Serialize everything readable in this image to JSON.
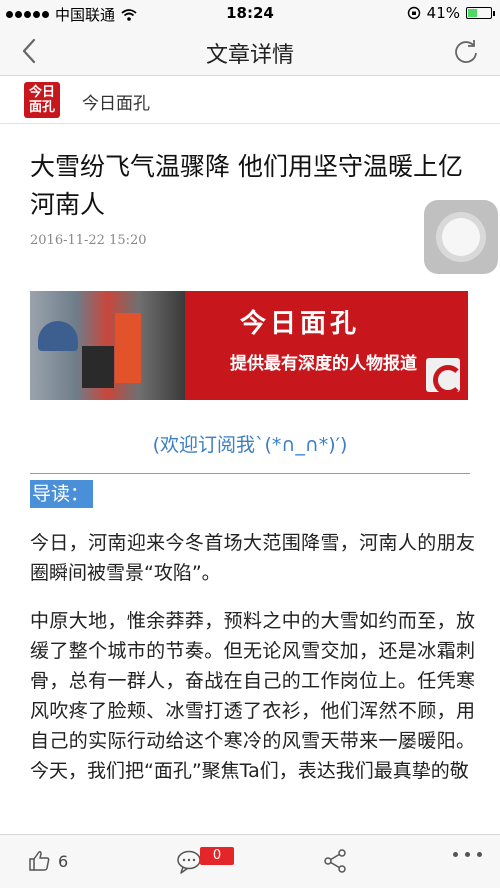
{
  "status_bar": {
    "carrier": "中国联通",
    "time": "18:24",
    "battery": "41%",
    "battery_level": 0.41
  },
  "nav": {
    "title": "文章详情"
  },
  "account": {
    "logo_text_line1": "今日",
    "logo_text_line2": "面孔",
    "name": "今日面孔"
  },
  "article": {
    "title": "大雪纷飞气温骤降 他们用坚守温暖上亿河南人",
    "date": "2016-11-22 15:20",
    "banner_title": "今日面孔",
    "banner_subtitle": "提供最有深度的人物报道",
    "subscribe_text": "(欢迎订阅我`(*∩_∩*)′)",
    "lead_label": "导读：",
    "paragraph1": "今日，河南迎来今冬首场大范围降雪，河南人的朋友圈瞬间被雪景“攻陷”。",
    "paragraph2": "中原大地，惟余莽莽，预料之中的大雪如约而至，放缓了整个城市的节奏。但无论风雪交加，还是冰霜刺骨，总有一群人，奋战在自己的工作岗位上。任凭寒风吹疼了脸颊、冰雪打透了衣衫，他们浑然不顾，用自己的实际行动给这个寒冷的风雪天带来一屡暖阳。今天，我们把“面孔”聚焦Ta们，表达我们最真挚的敬"
  },
  "toolbar": {
    "like_count": "6",
    "comment_count": "0"
  },
  "colors": {
    "brand_red": "#c8161d",
    "link_blue": "#3a7fc6",
    "highlight_blue": "#4a90d9",
    "badge_red": "#e4262b"
  },
  "icons": [
    "signal-dots-icon",
    "wifi-icon",
    "lock-rotation-icon",
    "battery-icon",
    "back-chevron-icon",
    "refresh-icon",
    "thumbs-up-icon",
    "comment-icon",
    "share-icon",
    "more-icon",
    "assistive-touch-icon"
  ]
}
